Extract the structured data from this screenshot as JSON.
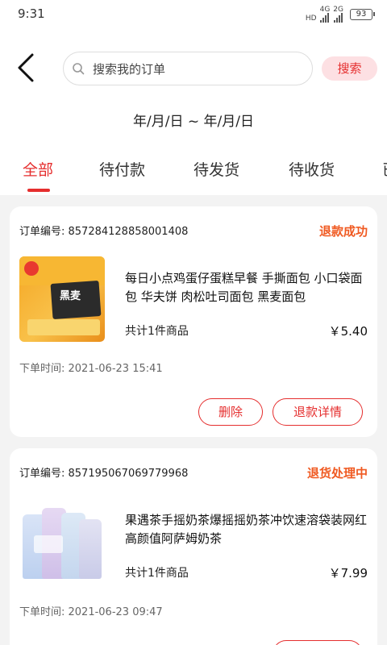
{
  "status_bar": {
    "time": "9:31",
    "network_1": "4G",
    "network_2": "2G",
    "hd": "HD",
    "battery": "93"
  },
  "search": {
    "placeholder": "搜索我的订单",
    "button_label": "搜索"
  },
  "date_range": "年/月/日 ~ 年/月/日",
  "tabs": [
    {
      "label": "全部",
      "active": true
    },
    {
      "label": "待付款",
      "active": false
    },
    {
      "label": "待发货",
      "active": false
    },
    {
      "label": "待收货",
      "active": false
    },
    {
      "label": "已",
      "active": false
    }
  ],
  "orders": [
    {
      "order_no": "订单编号: 857284128858001408",
      "status": "退款成功",
      "product_name": "每日小点鸡蛋仔蛋糕早餐 手撕面包 小口袋面包 华夫饼 肉松吐司面包 黑麦面包",
      "count": "共计1件商品",
      "price": "￥5.40",
      "time": "下单时间: 2021-06-23 15:41",
      "product_img_text": "黑麦",
      "actions": [
        "删除",
        "退款详情"
      ]
    },
    {
      "order_no": "订单编号: 857195067069779968",
      "status": "退货处理中",
      "product_name": "果遇茶手摇奶茶爆摇摇奶茶冲饮速溶袋装网红高颜值阿萨姆奶茶",
      "count": "共计1件商品",
      "price": "￥7.99",
      "time": "下单时间: 2021-06-23 09:47",
      "actions": []
    }
  ],
  "colors": {
    "accent": "#e52e2e",
    "status_orange": "#f05a22"
  }
}
